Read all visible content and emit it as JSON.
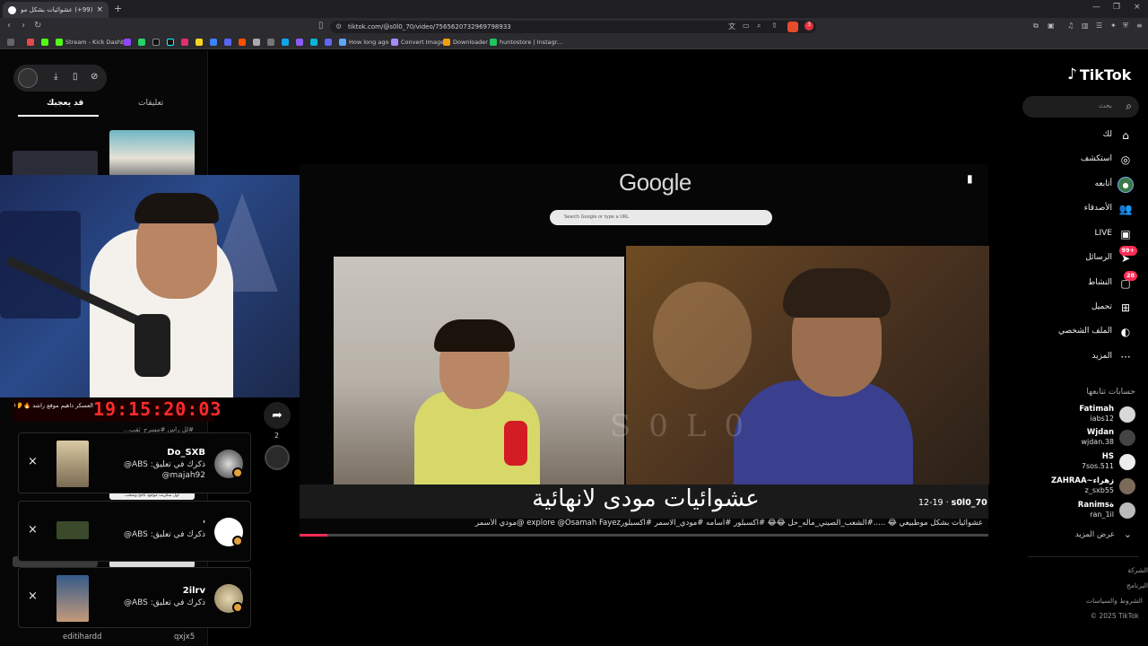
{
  "browser": {
    "tab_title": "(99+) عشوائيات بشكل موطبيعي...",
    "tab_close": "×",
    "new_tab": "+",
    "window_controls": [
      "—",
      "❐",
      "×"
    ],
    "nav": {
      "back": "‹",
      "forward": "›",
      "reload": "↻"
    },
    "url": "tiktok.com/@s0l0_70/video/7565620732969798933",
    "badge_count": "3",
    "bookmarks": [
      "Stream - Kick Dashb...",
      "How long ago",
      "Convert Image",
      "Downloader",
      "huntostore | Instagr..."
    ]
  },
  "left_panel": {
    "tabs": {
      "you_may_like": "قد يعجبك",
      "comments": "تعليقات"
    },
    "timer_message": "العسكر داهيم موقع راشد 🔥👂😂",
    "timer": "19:15:20:03",
    "hashtags": "#لل راس  #مسرح_ثقب...",
    "share_count": "2",
    "notifications": [
      {
        "name": "Do_SXB",
        "text": "ذكرك في تعليق: ABS@",
        "text2": "@majah92"
      },
      {
        "name": "'",
        "text": "ذكرك في تعليق: ABS@",
        "text2": ""
      },
      {
        "name": "2ilrv",
        "text": "ذكرك في تعليق: ABS@",
        "text2": ""
      }
    ],
    "close_label": "×",
    "bottom_names": [
      "editihardd",
      "qxjx5"
    ],
    "thumb_label": "أول سكربت موجود ناجح وسحب"
  },
  "video": {
    "google": "Google",
    "search_placeholder": "Search Google or type a URL",
    "caption": "عشوائيات مودى لانهائية",
    "author": "s0l0_70",
    "date": "12-19",
    "description": "عشوائيات بشكل موطبيعي 😂 .....#الشعب_الصيني_ماله_حل 😂😂 #اكسبلور #اسامه #مودي_الاسمر #اكسبلورexplore @Osamah Fayez @مودي الأسمر",
    "watermark": "S0L0",
    "progress": 0.04
  },
  "sidebar": {
    "logo": "TikTok",
    "search_placeholder": "بحث",
    "nav": [
      {
        "label": "لك",
        "icon": "home-icon",
        "glyph": "⌂"
      },
      {
        "label": "استكشف",
        "icon": "compass-icon",
        "glyph": "◎"
      },
      {
        "label": "أتابعه",
        "icon": "following-avatar-icon",
        "glyph": "●"
      },
      {
        "label": "الأصدقاء",
        "icon": "friends-icon",
        "glyph": "👥"
      },
      {
        "label": "LIVE",
        "icon": "live-icon",
        "glyph": "▣"
      },
      {
        "label": "الرسائل",
        "icon": "messages-icon",
        "glyph": "➤",
        "badge": "99+"
      },
      {
        "label": "النشاط",
        "icon": "activity-icon",
        "glyph": "▢",
        "badge": "28"
      },
      {
        "label": "تحميل",
        "icon": "upload-icon",
        "glyph": "⊞"
      },
      {
        "label": "الملف الشخصي",
        "icon": "profile-icon",
        "glyph": "◐"
      },
      {
        "label": "المزيد",
        "icon": "more-icon",
        "glyph": "···"
      }
    ],
    "following_title": "حسابات تتابعها",
    "following": [
      {
        "name": "Fatimah",
        "user": "iabs12"
      },
      {
        "name": "Wjdan",
        "user": "wjdan.38"
      },
      {
        "name": "HS",
        "user": "7sos.511"
      },
      {
        "name": "ZAHRAA~زهراء",
        "user": "z_sxb55"
      },
      {
        "name": "Ranimsة",
        "user": "ran_1il"
      }
    ],
    "see_more": "عرض المزيد",
    "footer": [
      "الشركة",
      "البرنامج",
      "الشروط والسياسات",
      "© 2025 TikTok"
    ]
  },
  "colors": {
    "accent": "#fe2c55",
    "timer": "#ff2a2a",
    "badge": "#e3a23a"
  }
}
